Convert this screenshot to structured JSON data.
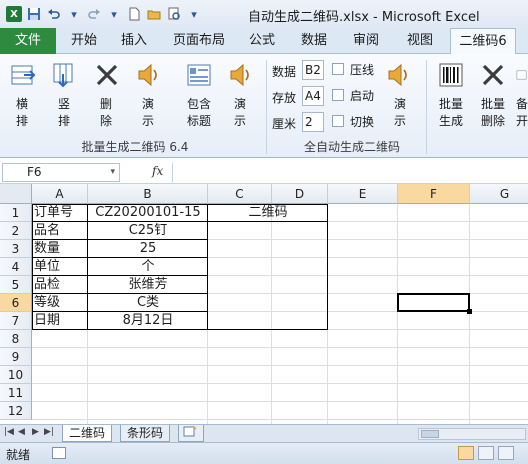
{
  "window": {
    "title": "自动生成二维码.xlsx  -  Microsoft Excel",
    "qat": [
      "save-icon",
      "undo-icon",
      "redo-icon",
      "new-icon",
      "open-icon",
      "print-preview-icon"
    ]
  },
  "ribbon_tabs": [
    "文件",
    "开始",
    "插入",
    "页面布局",
    "公式",
    "数据",
    "审阅",
    "视图",
    "二维码6"
  ],
  "ribbon": {
    "group1": {
      "label": "批量生成二维码 6.4",
      "buttons": [
        {
          "label1": "横",
          "label2": "排",
          "icon": "horizontal-layout-icon"
        },
        {
          "label1": "竖",
          "label2": "排",
          "icon": "vertical-layout-icon"
        },
        {
          "label1": "删",
          "label2": "除",
          "icon": "delete-icon"
        },
        {
          "label1": "演",
          "label2": "示",
          "icon": "speaker-icon"
        },
        {
          "label1": "包含",
          "label2": "标题",
          "icon": "include-title-icon"
        },
        {
          "label1": "演",
          "label2": "示",
          "icon": "speaker-icon"
        }
      ]
    },
    "group2": {
      "label": "全自动生成二维码",
      "fields": [
        {
          "label": "数据",
          "value": "B2"
        },
        {
          "label": "存放",
          "value": "A4"
        },
        {
          "label": "厘米",
          "value": "2"
        }
      ],
      "checks": [
        "压线",
        "启动",
        "切换"
      ],
      "demo": {
        "label1": "演",
        "label2": "示"
      }
    },
    "group3": {
      "buttons": [
        {
          "label1": "批量",
          "label2": "生成",
          "icon": "barcode-icon"
        },
        {
          "label1": "批量",
          "label2": "删除",
          "icon": "delete-icon"
        },
        {
          "label1": "备",
          "label2": "开",
          "icon": "backup-icon"
        }
      ]
    }
  },
  "formula_bar": {
    "name_box": "F6",
    "fx": "fx",
    "value": ""
  },
  "columns": [
    "A",
    "B",
    "C",
    "D",
    "E",
    "F",
    "G"
  ],
  "rows": [
    "1",
    "2",
    "3",
    "4",
    "5",
    "6",
    "7",
    "8",
    "9",
    "10",
    "11",
    "12"
  ],
  "selected_cell": "F6",
  "cells": {
    "A1": "订单号",
    "B1": "CZ20200101-15",
    "C1": "二维码",
    "A2": "品名",
    "B2": "C25钉",
    "A3": "数量",
    "B3": "25",
    "A4": "单位",
    "B4": "个",
    "A5": "品检",
    "B5": "张维芳",
    "A6": "等级",
    "B6": "C类",
    "A7": "日期",
    "B7": "8月12日"
  },
  "sheets": [
    "二维码",
    "条形码"
  ],
  "active_sheet": "二维码",
  "status": {
    "mode": "就绪"
  },
  "colors": {
    "file_tab": "#2d8a3e",
    "selected_header": "#f9d9a0"
  }
}
